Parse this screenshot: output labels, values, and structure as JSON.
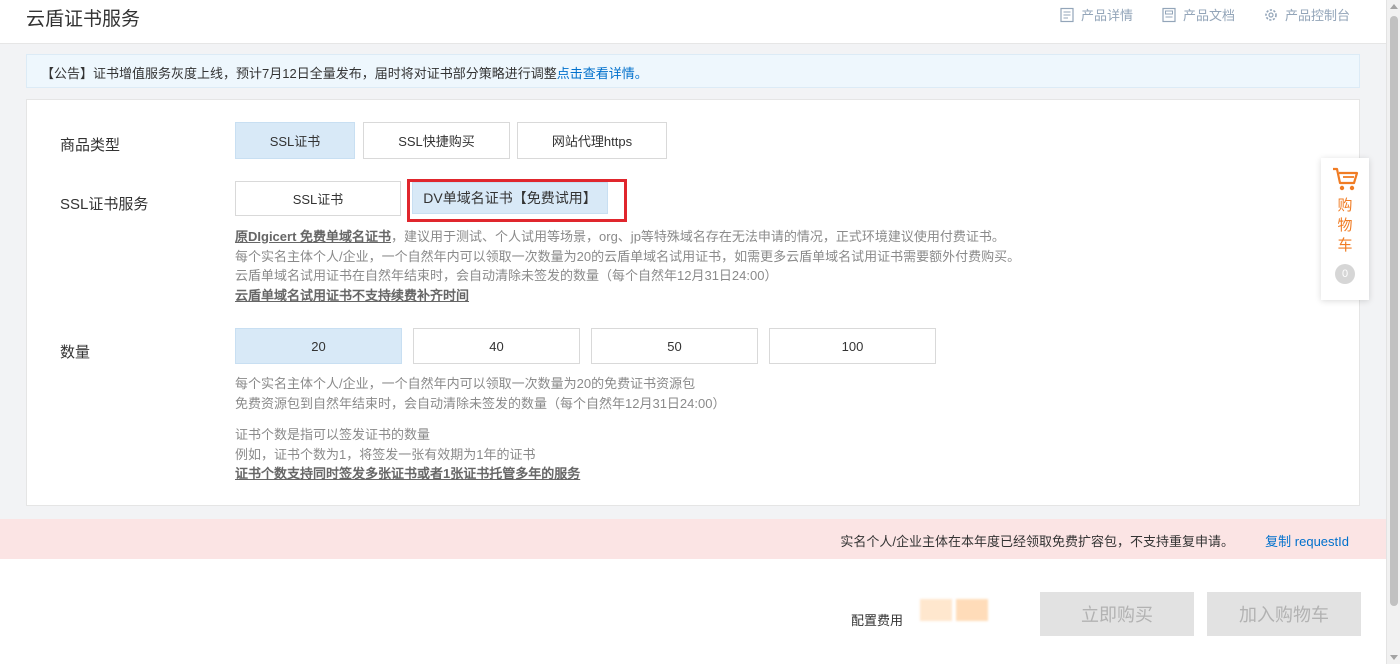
{
  "header": {
    "title": "云盾证书服务",
    "links": [
      {
        "label": "产品详情",
        "icon": "document-icon"
      },
      {
        "label": "产品文档",
        "icon": "file-icon"
      },
      {
        "label": "产品控制台",
        "icon": "gear-icon"
      }
    ]
  },
  "notice": {
    "text": "【公告】证书增值服务灰度上线，预计7月12日全量发布，届时将对证书部分策略进行调整",
    "link": "点击查看详情。"
  },
  "product_type": {
    "label": "商品类型",
    "options": [
      "SSL证书",
      "SSL快捷购买",
      "网站代理https"
    ],
    "selected": "SSL证书"
  },
  "ssl_service": {
    "label": "SSL证书服务",
    "options": [
      "SSL证书",
      "DV单域名证书【免费试用】"
    ],
    "selected": "DV单域名证书【免费试用】",
    "desc_lead": "原DIgicert 免费单域名证书",
    "desc_line1": "，建议用于测试、个人试用等场景，org、jp等特殊域名存在无法申请的情况，正式环境建议使用付费证书。",
    "desc_line2": "每个实名主体个人/企业，一个自然年内可以领取一次数量为20的云盾单域名试用证书，如需更多云盾单域名试用证书需要额外付费购买。",
    "desc_line3": "云盾单域名试用证书在自然年结束时，会自动清除未签发的数量（每个自然年12月31日24:00）",
    "desc_line4": "云盾单域名试用证书不支持续费补齐时间"
  },
  "quantity": {
    "label": "数量",
    "options": [
      "20",
      "40",
      "50",
      "100"
    ],
    "selected": "20",
    "desc_line1": "每个实名主体个人/企业，一个自然年内可以领取一次数量为20的免费证书资源包",
    "desc_line2": "免费资源包到自然年结束时，会自动清除未签发的数量（每个自然年12月31日24:00）",
    "desc_line3": "证书个数是指可以签发证书的数量",
    "desc_line4": "例如，证书个数为1，将签发一张有效期为1年的证书",
    "desc_line5": "证书个数支持同时签发多张证书或者1张证书托管多年的服务"
  },
  "error_bar": {
    "text": "实名个人/企业主体在本年度已经领取免费扩容包，不支持重复申请。",
    "link": "复制 requestId"
  },
  "footer": {
    "fee_label": "配置费用",
    "buy_now": "立即购买",
    "add_cart": "加入购物车"
  },
  "cart": {
    "text": "购物车",
    "count": "0",
    "icon": "cart-icon",
    "color": "#f07c24"
  },
  "colors": {
    "accent_link": "#0070cc",
    "selected_bg": "#d8e9f7",
    "highlight_border": "#e0262d",
    "error_bg": "#fbe4e4"
  }
}
